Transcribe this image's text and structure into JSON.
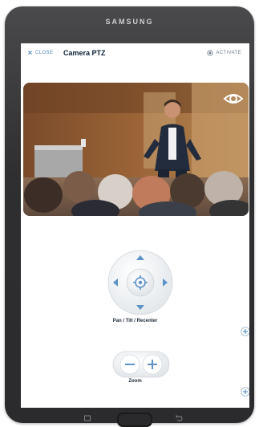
{
  "device": {
    "brand": "SAMSUNG"
  },
  "header": {
    "close_label": "CLOSE",
    "title": "Camera PTZ",
    "activate_label": "ACTIVATE"
  },
  "controls": {
    "ptz_label": "Pan / Tilt / Recenter",
    "zoom_label": "Zoom"
  },
  "colors": {
    "accent": "#4f87b8",
    "title": "#0f2336"
  }
}
